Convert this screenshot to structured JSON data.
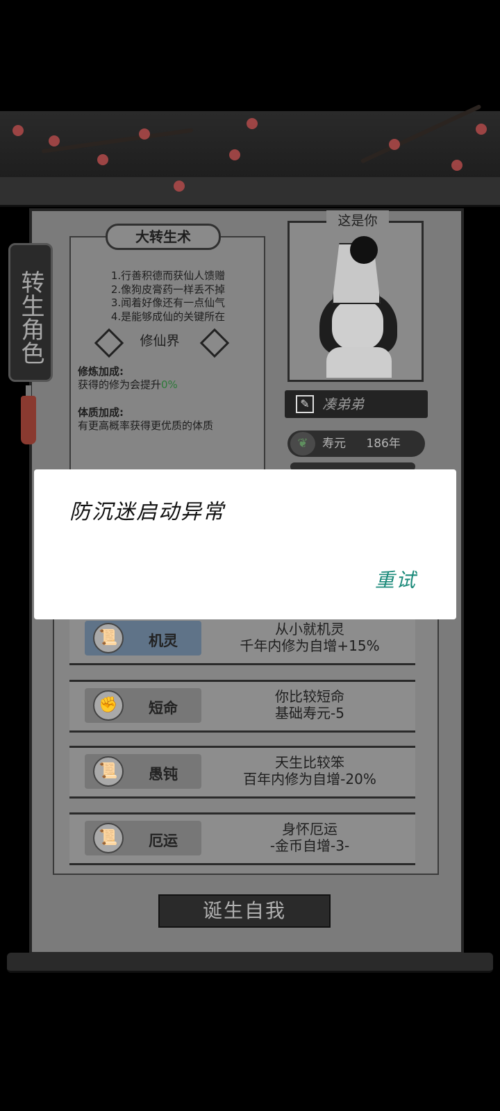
{
  "side_tab": {
    "label": "转生角色"
  },
  "info_panel": {
    "title": "大转生术",
    "rules": [
      "1.行善积德而获仙人馈赠",
      "2.像狗皮膏药一样丢不掉",
      "3.闻着好像还有一点仙气",
      "4.是能够成仙的关键所在"
    ],
    "realm": "修仙界",
    "cultivation_bonus": {
      "title": "修炼加成:",
      "text_prefix": "获得的修为会提升",
      "value": "0%"
    },
    "constitution_bonus": {
      "title": "体质加成:",
      "text": "有更高概率获得更优质的体质"
    }
  },
  "character": {
    "label": "这是你",
    "name": "凑弟弟",
    "lifespan_label": "寿元",
    "lifespan_value": "186年"
  },
  "traits": [
    {
      "name": "机灵",
      "icon": "scroll-icon",
      "desc_line1": "从小就机灵",
      "desc_line2": "千年内修为自增+15%",
      "highlight_color": "#5f7388"
    },
    {
      "name": "短命",
      "icon": "fist-icon",
      "desc_line1": "你比较短命",
      "desc_line2": "基础寿元-5",
      "highlight_color": "#777777"
    },
    {
      "name": "愚钝",
      "icon": "scroll-icon",
      "desc_line1": "天生比较笨",
      "desc_line2": "百年内修为自增-20%",
      "highlight_color": "#777777"
    },
    {
      "name": "厄运",
      "icon": "scroll-icon",
      "desc_line1": "身怀厄运",
      "desc_line2": "-金币自增-3-",
      "highlight_color": "#777777"
    }
  ],
  "birth_button": {
    "label": "诞生自我"
  },
  "dialog": {
    "message": "防沉迷启动异常",
    "retry_label": "重试",
    "retry_color": "#1b8a7a"
  }
}
